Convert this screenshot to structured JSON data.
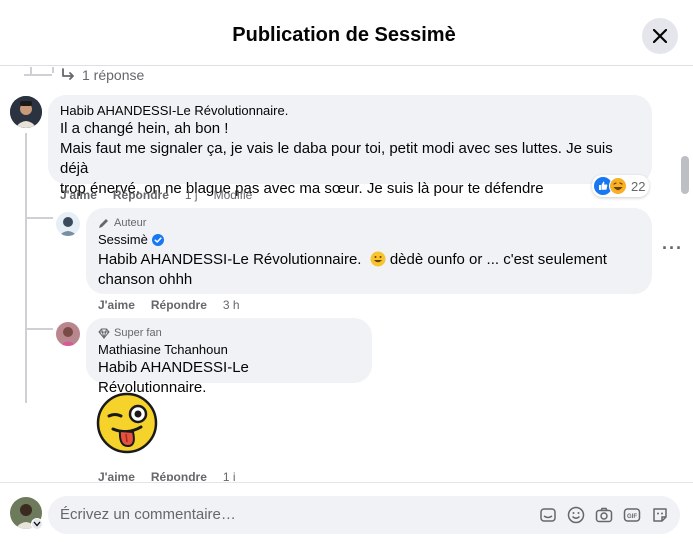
{
  "header": {
    "title": "Publication de Sessimè"
  },
  "thread": {
    "replies_label": "1 réponse"
  },
  "comments": [
    {
      "author": "Habib AHANDESSI-Le Révolutionnaire.",
      "lines": [
        "Il a changé hein, ah bon !",
        "Mais faut me signaler ça, je vais le daba pour toi, petit modi avec ses luttes. Je suis déjà",
        "trop énervé, on ne blague pas avec ma sœur. Je suis là pour te défendre"
      ],
      "like": "J'aime",
      "reply": "Répondre",
      "time": "1 j",
      "edited": "Modifié",
      "reaction_count": "22"
    },
    {
      "badge": "Auteur",
      "author": "Sessimè",
      "mention": "Habib AHANDESSI-Le Révolutionnaire.",
      "text_after": " dèdè ounfo or ... c'est seulement",
      "line2": "chanson ohhh",
      "like": "J'aime",
      "reply": "Répondre",
      "time": "3 h"
    },
    {
      "badge": "Super fan",
      "author": "Mathiasine Tchanhoun",
      "mention": "Habib AHANDESSI-Le Révolutionnaire.",
      "like": "J'aime",
      "reply": "Répondre",
      "time": "1 j"
    }
  ],
  "composer": {
    "placeholder": "Écrivez un commentaire…"
  },
  "icons": [
    "close-icon",
    "reply-arrow-icon",
    "verified-icon",
    "pencil-icon",
    "diamond-icon",
    "sticker-icon",
    "emoji-icon",
    "camera-icon",
    "gif-icon",
    "avatar-sticker-icon"
  ],
  "colors": {
    "accent": "#1877f2",
    "bubble": "#f0f2f5",
    "muted": "#65676b"
  }
}
